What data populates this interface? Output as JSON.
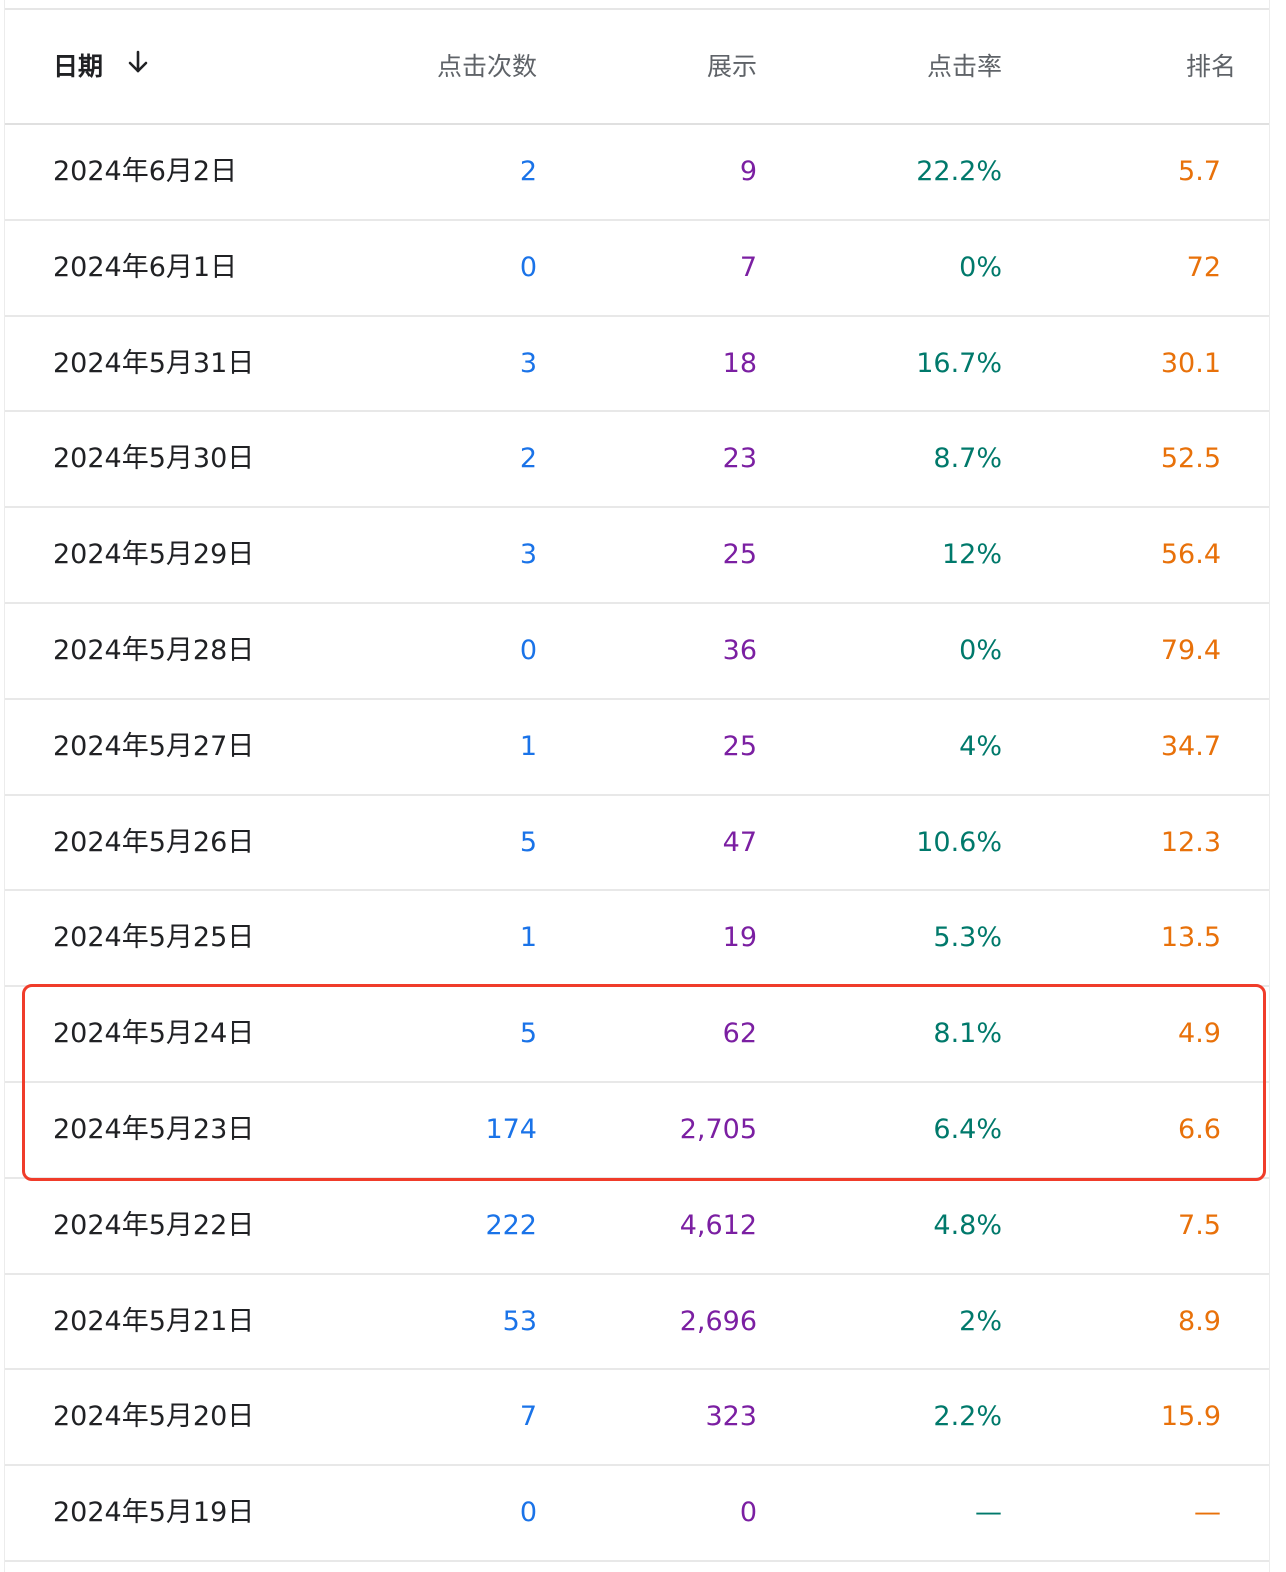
{
  "table": {
    "columns": {
      "date": "日期",
      "clicks": "点击次数",
      "impressions": "展示",
      "ctr": "点击率",
      "position": "排名"
    },
    "sort_icon": "arrow-down-icon",
    "rows": [
      {
        "date": "2024年6月2日",
        "clicks": "2",
        "impressions": "9",
        "ctr": "22.2%",
        "position": "5.7"
      },
      {
        "date": "2024年6月1日",
        "clicks": "0",
        "impressions": "7",
        "ctr": "0%",
        "position": "72"
      },
      {
        "date": "2024年5月31日",
        "clicks": "3",
        "impressions": "18",
        "ctr": "16.7%",
        "position": "30.1"
      },
      {
        "date": "2024年5月30日",
        "clicks": "2",
        "impressions": "23",
        "ctr": "8.7%",
        "position": "52.5"
      },
      {
        "date": "2024年5月29日",
        "clicks": "3",
        "impressions": "25",
        "ctr": "12%",
        "position": "56.4"
      },
      {
        "date": "2024年5月28日",
        "clicks": "0",
        "impressions": "36",
        "ctr": "0%",
        "position": "79.4"
      },
      {
        "date": "2024年5月27日",
        "clicks": "1",
        "impressions": "25",
        "ctr": "4%",
        "position": "34.7"
      },
      {
        "date": "2024年5月26日",
        "clicks": "5",
        "impressions": "47",
        "ctr": "10.6%",
        "position": "12.3"
      },
      {
        "date": "2024年5月25日",
        "clicks": "1",
        "impressions": "19",
        "ctr": "5.3%",
        "position": "13.5"
      },
      {
        "date": "2024年5月24日",
        "clicks": "5",
        "impressions": "62",
        "ctr": "8.1%",
        "position": "4.9"
      },
      {
        "date": "2024年5月23日",
        "clicks": "174",
        "impressions": "2,705",
        "ctr": "6.4%",
        "position": "6.6"
      },
      {
        "date": "2024年5月22日",
        "clicks": "222",
        "impressions": "4,612",
        "ctr": "4.8%",
        "position": "7.5"
      },
      {
        "date": "2024年5月21日",
        "clicks": "53",
        "impressions": "2,696",
        "ctr": "2%",
        "position": "8.9"
      },
      {
        "date": "2024年5月20日",
        "clicks": "7",
        "impressions": "323",
        "ctr": "2.2%",
        "position": "15.9"
      },
      {
        "date": "2024年5月19日",
        "clicks": "0",
        "impressions": "0",
        "ctr": "—",
        "position": "—"
      }
    ],
    "highlighted_rows": [
      "2024年5月24日",
      "2024年5月23日"
    ]
  },
  "colors": {
    "clicks": "#1a73e8",
    "impressions": "#7b1fa2",
    "ctr": "#00796b",
    "position": "#e8710a",
    "highlight": "#f03c2a"
  }
}
